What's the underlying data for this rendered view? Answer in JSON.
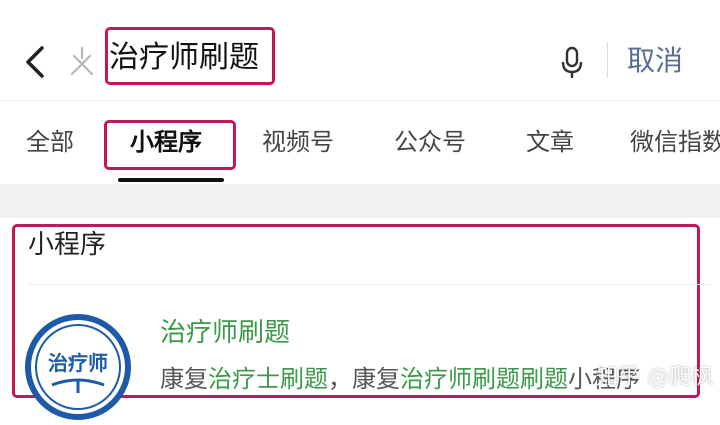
{
  "search": {
    "query": "治疗师刷题",
    "cancel_label": "取消"
  },
  "tabs": [
    {
      "label": "全部"
    },
    {
      "label": "小程序"
    },
    {
      "label": "视频号"
    },
    {
      "label": "公众号"
    },
    {
      "label": "文章"
    },
    {
      "label": "微信指数"
    }
  ],
  "results": {
    "section_title": "小程序",
    "item": {
      "name": "治疗师刷题",
      "logo_text": "治疗师",
      "desc_parts": [
        "康复",
        "治疗士",
        "刷题",
        "，康复",
        "治疗师",
        "刷题",
        "刷题",
        "小程序"
      ]
    }
  },
  "watermark": "知乎 @爬枫",
  "colors": {
    "highlight_box": "#c2185b",
    "link_blue": "#576b95",
    "match_green": "#3a9a4a",
    "logo_blue": "#1e5aa8"
  }
}
